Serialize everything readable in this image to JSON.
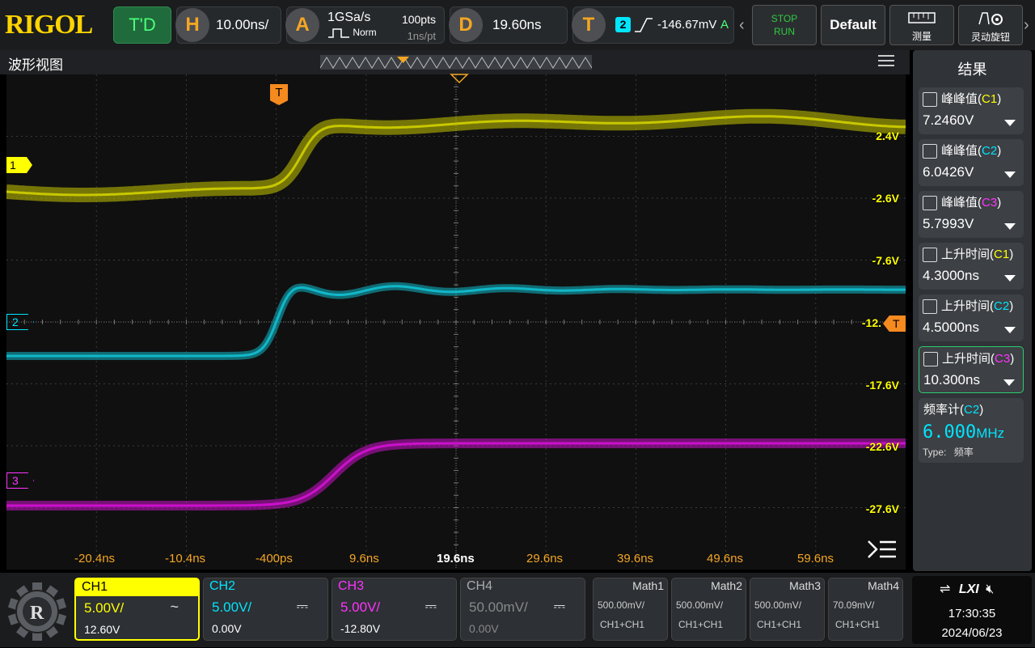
{
  "brand": "RIGOL",
  "topbar": {
    "mode": "T'D",
    "h_label": "H",
    "timebase": "10.00ns/",
    "a_label": "A",
    "sample_rate": "1GSa/s",
    "acq_mode": "Norm",
    "mem_depth": "100pts",
    "sample_interval": "1ns/pt",
    "d_label": "D",
    "delay": "19.60ns",
    "t_label": "T",
    "trig_source": "2",
    "trig_level": "-146.67mV",
    "trig_mode": "A",
    "stop_label": "STOP",
    "run_label": "RUN",
    "default_label": "Default",
    "measure_label": "测量",
    "knob_label": "灵动旋钮"
  },
  "waveform_view": {
    "title": "波形视图",
    "trigger_marker": "T",
    "channel_markers": [
      "1",
      "2",
      "3"
    ],
    "y_labels": [
      "2.4V",
      "-2.6V",
      "-7.6V",
      "-12.",
      "-17.6V",
      "-22.6V",
      "-27.6V"
    ],
    "x_labels": [
      "-20.4ns",
      "-10.4ns",
      "-400ps",
      "9.6ns",
      "19.6ns",
      "29.6ns",
      "39.6ns",
      "49.6ns",
      "59.6ns"
    ]
  },
  "results": {
    "title": "结果",
    "items": [
      {
        "name": "峰峰值",
        "src": "C1",
        "value": "7.2460V",
        "src_color": "#ffff00"
      },
      {
        "name": "峰峰值",
        "src": "C2",
        "value": "6.0426V",
        "src_color": "#00e5ff"
      },
      {
        "name": "峰峰值",
        "src": "C3",
        "value": "5.7993V",
        "src_color": "#ff33ff"
      },
      {
        "name": "上升时间",
        "src": "C1",
        "value": "4.3000ns",
        "src_color": "#ffff00"
      },
      {
        "name": "上升时间",
        "src": "C2",
        "value": "4.5000ns",
        "src_color": "#00e5ff"
      },
      {
        "name": "上升时间",
        "src": "C3",
        "value": "10.300ns",
        "src_color": "#ff33ff"
      }
    ],
    "counter": {
      "name": "频率计",
      "src": "C2",
      "value": "6.000",
      "unit": "MHz",
      "type_label": "Type:",
      "type_value": "频率"
    }
  },
  "channels": [
    {
      "name": "CH1",
      "scale": "5.00V/",
      "offset": "12.60V",
      "coupling": "~",
      "color": "#ffff00"
    },
    {
      "name": "CH2",
      "scale": "5.00V/",
      "offset": "0.00V",
      "coupling": "⎓",
      "color": "#00e5ff"
    },
    {
      "name": "CH3",
      "scale": "5.00V/",
      "offset": "-12.80V",
      "coupling": "⎓",
      "color": "#ff33ff"
    },
    {
      "name": "CH4",
      "scale": "50.00mV/",
      "offset": "0.00V",
      "coupling": "⎓",
      "color": "#888888"
    }
  ],
  "math": [
    {
      "name": "Math1",
      "scale": "500.00mV/",
      "expr": "CH1+CH1"
    },
    {
      "name": "Math2",
      "scale": "500.00mV/",
      "expr": "CH1+CH1"
    },
    {
      "name": "Math3",
      "scale": "500.00mV/",
      "expr": "CH1+CH1"
    },
    {
      "name": "Math4",
      "scale": "70.09mV/",
      "expr": "CH1+CH1"
    }
  ],
  "status": {
    "lxi": "LXI",
    "time": "17:30:35",
    "date": "2024/06/23"
  }
}
